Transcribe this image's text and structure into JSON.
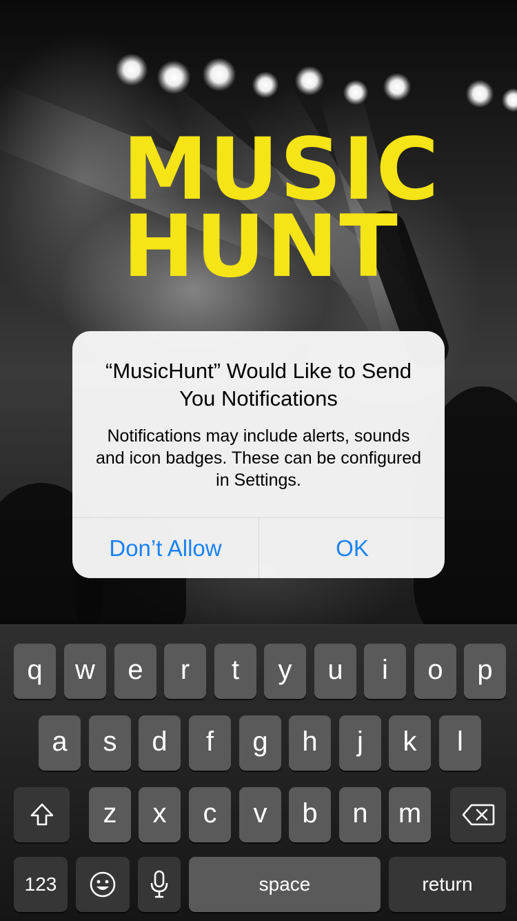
{
  "logo": {
    "line1": "MUSIC",
    "line2": "HUNT"
  },
  "alert": {
    "title": "“MusicHunt” Would Like to Send You Notifications",
    "message": "Notifications may include alerts, sounds and icon badges. These can be configured in Settings.",
    "dont_allow": "Don’t Allow",
    "ok": "OK"
  },
  "keyboard": {
    "row1": [
      "q",
      "w",
      "e",
      "r",
      "t",
      "y",
      "u",
      "i",
      "o",
      "p"
    ],
    "row2": [
      "a",
      "s",
      "d",
      "f",
      "g",
      "h",
      "j",
      "k",
      "l"
    ],
    "row3": [
      "z",
      "x",
      "c",
      "v",
      "b",
      "n",
      "m"
    ],
    "numbers": "123",
    "space": "space",
    "return": "return",
    "icons": {
      "shift": "shift-icon",
      "delete": "delete-icon",
      "emoji": "emoji-icon",
      "mic": "microphone-icon"
    }
  },
  "colors": {
    "logo": "#f5e416",
    "alert_button": "#1a82f7"
  }
}
